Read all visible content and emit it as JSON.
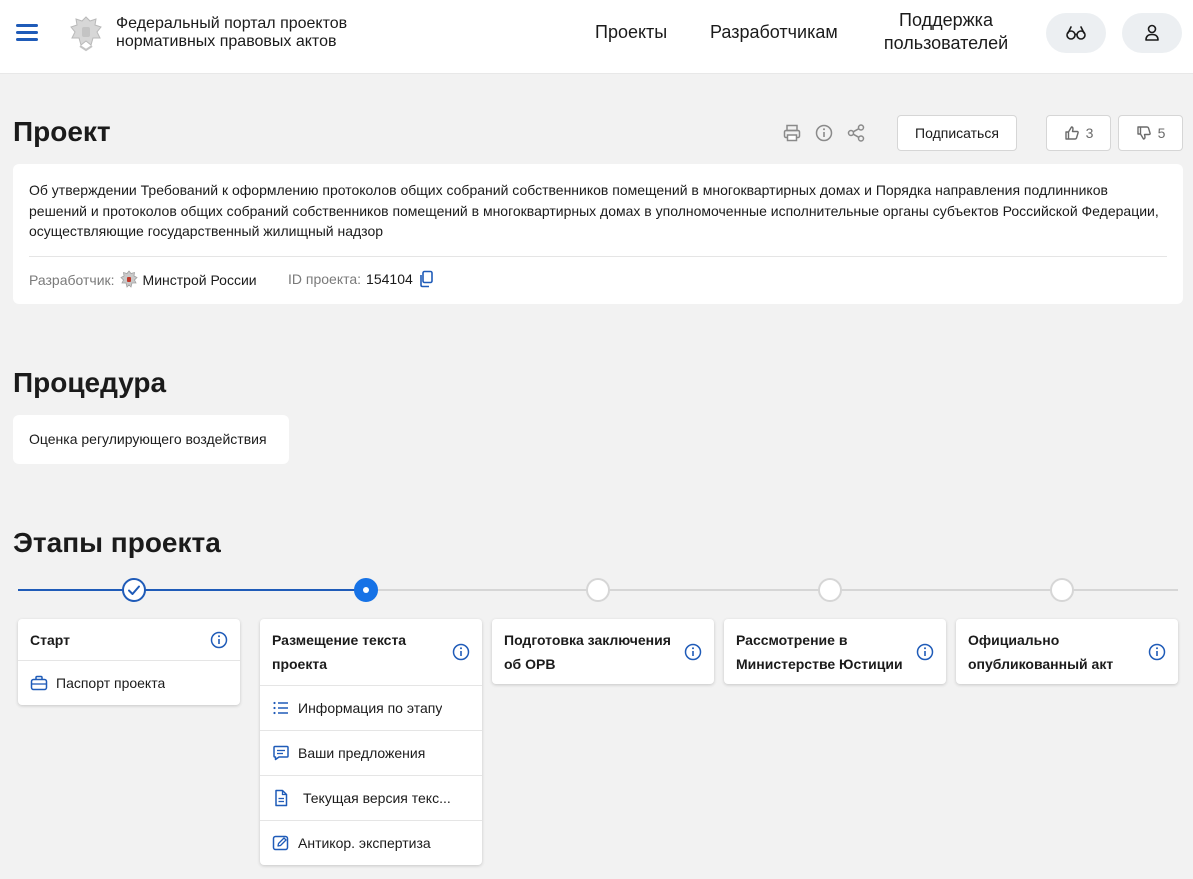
{
  "header": {
    "portal_title": "Федеральный портал проектов нормативных правовых актов",
    "nav": {
      "projects": "Проекты",
      "developers": "Разработчикам",
      "support": "Поддержка пользователей"
    }
  },
  "project": {
    "title": "Проект",
    "subscribe_label": "Подписаться",
    "likes": "3",
    "dislikes": "5",
    "description": "Об утверждении Требований к оформлению протоколов общих собраний собственников помещений в многоквартирных домах и Порядка направления подлинников решений и протоколов общих собраний собственников помещений в многоквартирных домах в уполномоченные исполнительные органы субъектов Российской Федерации, осуществляющие государственный жилищный надзор",
    "developer_label": "Разработчик:",
    "developer": "Минстрой России",
    "id_label": "ID проекта:",
    "id": "154104"
  },
  "procedure": {
    "title": "Процедура",
    "value": "Оценка регулирующего воздействия"
  },
  "stages": {
    "title": "Этапы проекта",
    "items": [
      {
        "name": "Старт",
        "status": "done",
        "links": [
          {
            "label": "Паспорт проекта",
            "icon": "briefcase-icon"
          }
        ]
      },
      {
        "name": "Размещение текста проекта",
        "status": "current",
        "links": [
          {
            "label": "Информация по этапу",
            "icon": "list-icon"
          },
          {
            "label": "Ваши предложения",
            "icon": "comment-icon"
          },
          {
            "label": "Текущая версия текс...",
            "icon": "document-icon"
          },
          {
            "label": "Антикор. экспертиза",
            "icon": "edit-icon"
          }
        ]
      },
      {
        "name": "Подготовка заключения об ОРВ",
        "status": "pending",
        "links": []
      },
      {
        "name": "Рассмотрение в Министерстве Юстиции",
        "status": "pending",
        "links": []
      },
      {
        "name": "Официально опубликованный акт",
        "status": "pending",
        "links": []
      }
    ]
  },
  "colors": {
    "accent": "#1f5bb8",
    "current_step": "#1672e6",
    "background": "#f2f2f2"
  }
}
